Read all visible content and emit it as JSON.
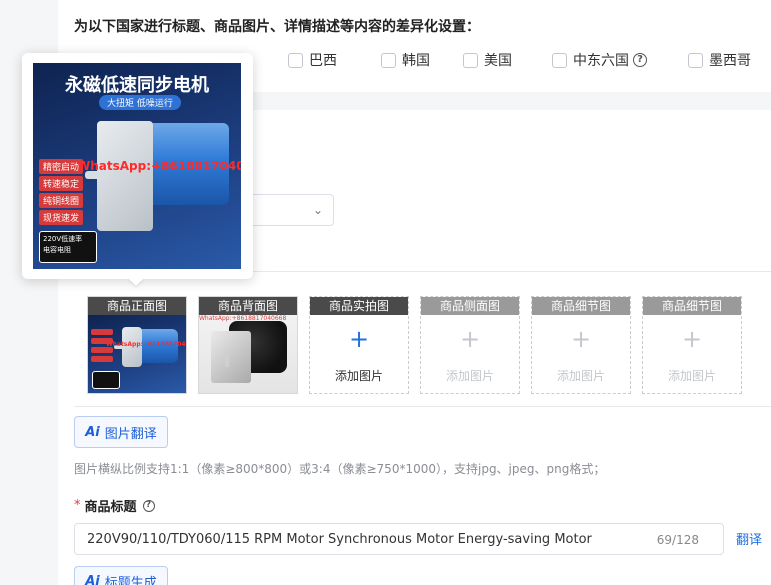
{
  "settings": {
    "heading": "为以下国家进行标题、商品图片、详情描述等内容的差异化设置：",
    "countries": [
      {
        "label": "巴西"
      },
      {
        "label": "韩国"
      },
      {
        "label": "美国"
      },
      {
        "label": "中东六国"
      },
      {
        "label": "墨西哥"
      }
    ],
    "help_symbol": "?"
  },
  "select": {
    "chevron": "⌄"
  },
  "images": {
    "slots": [
      {
        "label": "商品正面图",
        "add_text": ""
      },
      {
        "label": "商品背面图",
        "add_text": ""
      },
      {
        "label": "商品实拍图",
        "add_text": "添加图片"
      },
      {
        "label": "商品侧面图",
        "add_text": "添加图片"
      },
      {
        "label": "商品细节图",
        "add_text": "添加图片"
      },
      {
        "label": "商品细节图",
        "add_text": "添加图片"
      }
    ],
    "plus": "+",
    "translate_button": "图片翻译",
    "ai_glyph": "Ai",
    "hint": "图片横纵比例支持1:1（像素≥800*800）或3:4（像素≥750*1000），支持jpg、jpeg、png格式；"
  },
  "product_title": {
    "label": "商品标题",
    "required_mark": "*",
    "help_symbol": "?",
    "value": "220V90/110/TDY060/115 RPM Motor Synchronous Motor Energy-saving Motor",
    "count": "69/128",
    "translate_link": "翻译",
    "generate_button": "标题生成"
  },
  "preview": {
    "title": "永磁低速同步电机",
    "subtitle": "大扭矩 低噪运行",
    "tags": [
      "精密启动",
      "转速稳定",
      "纯铜线圈",
      "现货速发"
    ],
    "watermark": "WhatsApp:+8618817040668",
    "badge_line1": "220V低速率",
    "badge_line2": "电容电阻"
  }
}
